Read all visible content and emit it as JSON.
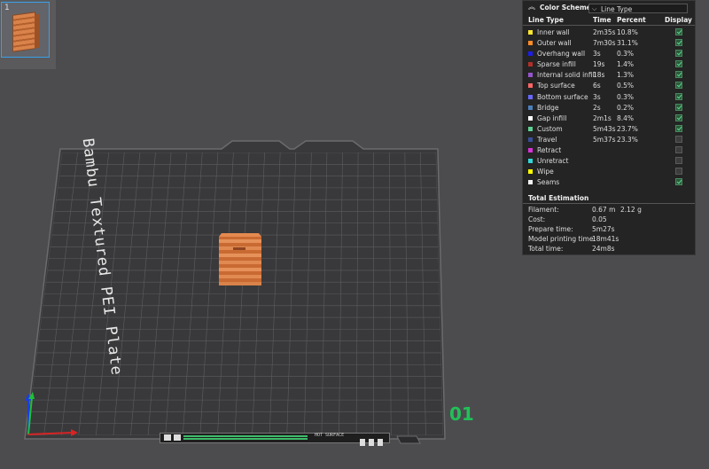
{
  "thumbnail": {
    "number": "1"
  },
  "plate": {
    "label": "Bambu Textured PEI Plate",
    "plate_number": "01"
  },
  "bottom_bar": {
    "hot_surface_text": "HOT SURFACE"
  },
  "color_scheme": {
    "title": "Color Scheme",
    "selected": "Line Type",
    "columns": {
      "line_type": "Line Type",
      "time": "Time",
      "percent": "Percent",
      "display": "Display"
    },
    "rows": [
      {
        "name": "Inner wall",
        "time": "2m35s",
        "percent": "10.8%",
        "color": "#ffe630",
        "display": true
      },
      {
        "name": "Outer wall",
        "time": "7m30s",
        "percent": "31.1%",
        "color": "#ff8c28",
        "display": true
      },
      {
        "name": "Overhang wall",
        "time": "3s",
        "percent": "0.3%",
        "color": "#1e1ee6",
        "display": true
      },
      {
        "name": "Sparse infill",
        "time": "19s",
        "percent": "1.4%",
        "color": "#b03029",
        "display": true
      },
      {
        "name": "Internal solid infill",
        "time": "18s",
        "percent": "1.3%",
        "color": "#9654cc",
        "display": true
      },
      {
        "name": "Top surface",
        "time": "6s",
        "percent": "0.5%",
        "color": "#ff6666",
        "display": true
      },
      {
        "name": "Bottom surface",
        "time": "3s",
        "percent": "0.3%",
        "color": "#6668ff",
        "display": true
      },
      {
        "name": "Bridge",
        "time": "2s",
        "percent": "0.2%",
        "color": "#4d80ba",
        "display": true
      },
      {
        "name": "Gap infill",
        "time": "2m1s",
        "percent": "8.4%",
        "color": "#ffffff",
        "display": true
      },
      {
        "name": "Custom",
        "time": "5m43s",
        "percent": "23.7%",
        "color": "#5ed194",
        "display": true
      },
      {
        "name": "Travel",
        "time": "5m37s",
        "percent": "23.3%",
        "color": "#384f99",
        "display": false
      },
      {
        "name": "Retract",
        "time": "",
        "percent": "",
        "color": "#d633d6",
        "display": false
      },
      {
        "name": "Unretract",
        "time": "",
        "percent": "",
        "color": "#33d6d6",
        "display": false
      },
      {
        "name": "Wipe",
        "time": "",
        "percent": "",
        "color": "#ffff00",
        "display": false
      },
      {
        "name": "Seams",
        "time": "",
        "percent": "",
        "color": "#f2f2f2",
        "display": true
      }
    ]
  },
  "total_estimation": {
    "title": "Total Estimation",
    "rows": [
      {
        "label": "Filament:",
        "value": "0.67 m",
        "value2": "2.12 g"
      },
      {
        "label": "Cost:",
        "value": "0.05",
        "value2": ""
      },
      {
        "label": "Prepare time:",
        "value": "5m27s",
        "value2": ""
      },
      {
        "label": "Model printing time:",
        "value": "18m41s",
        "value2": ""
      },
      {
        "label": "Total time:",
        "value": "24m8s",
        "value2": ""
      }
    ]
  }
}
